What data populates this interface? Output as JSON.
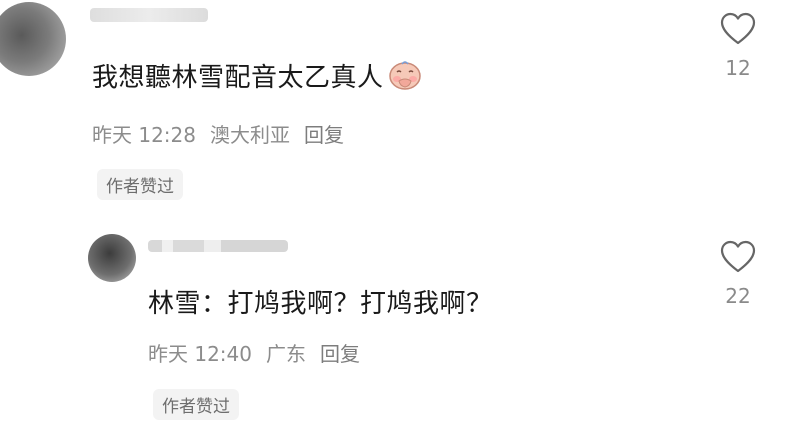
{
  "comment": {
    "text": "我想聽林雪配音太乙真人",
    "time": "昨天 12:28",
    "location": "澳大利亚",
    "reply_label": "回复",
    "author_liked": "作者赞过",
    "likes": "12",
    "emoji": "face-covering-mouth-icon"
  },
  "reply": {
    "text": "林雪：打鸠我啊？打鸠我啊？",
    "time": "昨天 12:40",
    "location": "广东",
    "reply_label": "回复",
    "author_liked": "作者赞过",
    "likes": "22"
  },
  "icons": {
    "like": "heart-outline-icon"
  },
  "colors": {
    "text_primary": "#1a1a1a",
    "text_secondary": "#8c8c8c",
    "badge_bg": "#f3f3f3"
  }
}
